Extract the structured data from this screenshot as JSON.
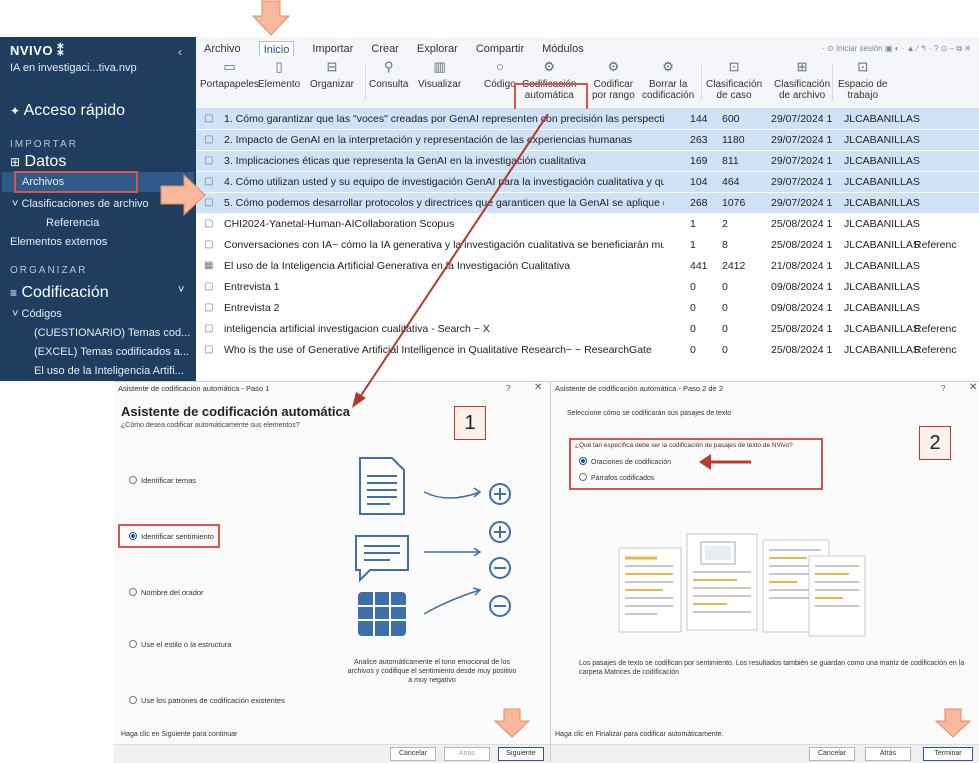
{
  "nvivo": {
    "brand": "NVIVO",
    "project_file": "IA en investigaci...tiva.nvp",
    "quick_access": "Acceso rápido",
    "section_import": "IMPORTAR",
    "group_data": "Datos",
    "item_files": "Archivos",
    "item_file_classifications": "Clasificaciones de archivo",
    "item_reference": "Referencia",
    "item_external": "Elementos externos",
    "section_organize": "ORGANIZAR",
    "group_coding": "Codificación",
    "item_codes": "Códigos",
    "code_1": "(CUESTIONARIO) Temas cod...",
    "code_2": "(EXCEL) Temas codificados a...",
    "code_3": "El uso de la Inteligencia Artifi..."
  },
  "ribbon": {
    "tabs": [
      "Archivo",
      "Inicio",
      "Importar",
      "Crear",
      "Explorar",
      "Compartir",
      "Módulos"
    ],
    "right_text": "Iniciar sesión",
    "tools": {
      "portapapeles": "Portapapeles",
      "elemento": "Elemento",
      "organizar": "Organizar",
      "consulta": "Consulta",
      "visualizar": "Visualizar",
      "codigo": "Código",
      "auto_coding_1": "Codificación",
      "auto_coding_2": "automática",
      "range_1": "Codificar",
      "range_2": "por rango",
      "erase_1": "Borrar la",
      "erase_2": "codificación",
      "case_class_1": "Clasificación",
      "case_class_2": "de caso",
      "file_class_1": "Clasificación",
      "file_class_2": "de archivo",
      "workspace_1": "Espacio de",
      "workspace_2": "trabajo"
    }
  },
  "files": [
    {
      "name": "1. Cómo garantizar que las \"voces\" creadas por GenAI representen con precisión las perspectivas",
      "codes": "144",
      "refs": "600",
      "date": "29/07/2024 1",
      "user": "JLCABANILLAS",
      "extra": ""
    },
    {
      "name": "2. Impacto de GenAI en la interpretación y representación de las experiencias humanas",
      "codes": "263",
      "refs": "1180",
      "date": "29/07/2024 1",
      "user": "JLCABANILLAS",
      "extra": ""
    },
    {
      "name": "3. Implicaciones éticas que representa la GenAI en la investigación cualitativa",
      "codes": "169",
      "refs": "811",
      "date": "29/07/2024 1",
      "user": "JLCABANILLAS",
      "extra": ""
    },
    {
      "name": "4. Cómo utilizan usted y su equipo de investigación GenAI para la investigación cualitativa y qué",
      "codes": "104",
      "refs": "464",
      "date": "29/07/2024 1",
      "user": "JLCABANILLAS",
      "extra": ""
    },
    {
      "name": "5. Cómo podemos desarrollar protocolos y directrices que garanticen que la GenAI se aplique de",
      "codes": "268",
      "refs": "1076",
      "date": "29/07/2024 1",
      "user": "JLCABANILLAS",
      "extra": ""
    },
    {
      "name": "CHI2024-Yanetal-Human-AICollaboration Scopus",
      "codes": "1",
      "refs": "2",
      "date": "25/08/2024 1",
      "user": "JLCABANILLAS",
      "extra": ""
    },
    {
      "name": "Conversaciones con IA~ cómo la IA generativa y la investigación cualitativa se beneficiarán mutu",
      "codes": "1",
      "refs": "8",
      "date": "25/08/2024 1",
      "user": "JLCABANILLAS",
      "extra": "Referenc"
    },
    {
      "name": "El uso de la Inteligencia Artificial Generativa en la Investigación Cualitativa",
      "codes": "441",
      "refs": "2412",
      "date": "21/08/2024 1",
      "user": "JLCABANILLAS",
      "extra": ""
    },
    {
      "name": "Entrevista 1",
      "codes": "0",
      "refs": "0",
      "date": "09/08/2024 1",
      "user": "JLCABANILLAS",
      "extra": ""
    },
    {
      "name": "Entrevista 2",
      "codes": "0",
      "refs": "0",
      "date": "09/08/2024 1",
      "user": "JLCABANILLAS",
      "extra": ""
    },
    {
      "name": "inteligencia artificial investigacion cualitativa - Search ~ X",
      "codes": "0",
      "refs": "0",
      "date": "25/08/2024 1",
      "user": "JLCABANILLAS",
      "extra": "Referenc"
    },
    {
      "name": "Who is the use of Generative Artificial Intelligence in Qualitative Research~ ~ ResearchGate",
      "codes": "0",
      "refs": "0",
      "date": "25/08/2024 1",
      "user": "JLCABANILLAS",
      "extra": "Referenc"
    }
  ],
  "dialog1": {
    "window_title": "Asistente de codificación automática - Paso 1",
    "help": "?",
    "close": "✕",
    "heading": "Asistente de codificación automática",
    "subheading": "¿Cómo desea codificar automáticamente sus elementos?",
    "options": [
      "Identificar temas",
      "Identificar sentimiento",
      "Nombre del orador",
      "Use el estilo o la estructura",
      "Use los patrones de codificación existentes"
    ],
    "step_badge": "1",
    "description": "Analice automáticamente el tono emocional de los archivos y codifique el sentimiento desde muy positivo a muy negativo",
    "footer": "Haga clic en Siguiente para continuar",
    "btn_cancel": "Cancelar",
    "btn_back": "Atrás",
    "btn_next": "Siguiente"
  },
  "dialog2": {
    "window_title": "Asistente de codificación automática - Paso 2 de 2",
    "help": "?",
    "close": "✕",
    "subheading": "Seleccione cómo se codificarán sus pasajes de texto",
    "question": "¿Qué tan específica debe ser la codificación de pasajes de texto de NVivo?",
    "options": [
      "Oraciones de codificación",
      "Párrafos codificados"
    ],
    "step_badge": "2",
    "description": "Los pasajes de texto se codifican por sentimiento. Los resultados también se guardan como una matriz de codificación en la carpeta Matrices de codificación",
    "footer": "Haga clic en Finalizar para codificar automáticamente.",
    "btn_cancel": "Cancelar",
    "btn_back": "Atrás",
    "btn_finish": "Terminar"
  },
  "colors": {
    "sidebar": "#1f3d5f",
    "highlight": "#cfe2f6",
    "annotation_red": "#d9534f",
    "annotation_arrow": "#f4a582"
  }
}
